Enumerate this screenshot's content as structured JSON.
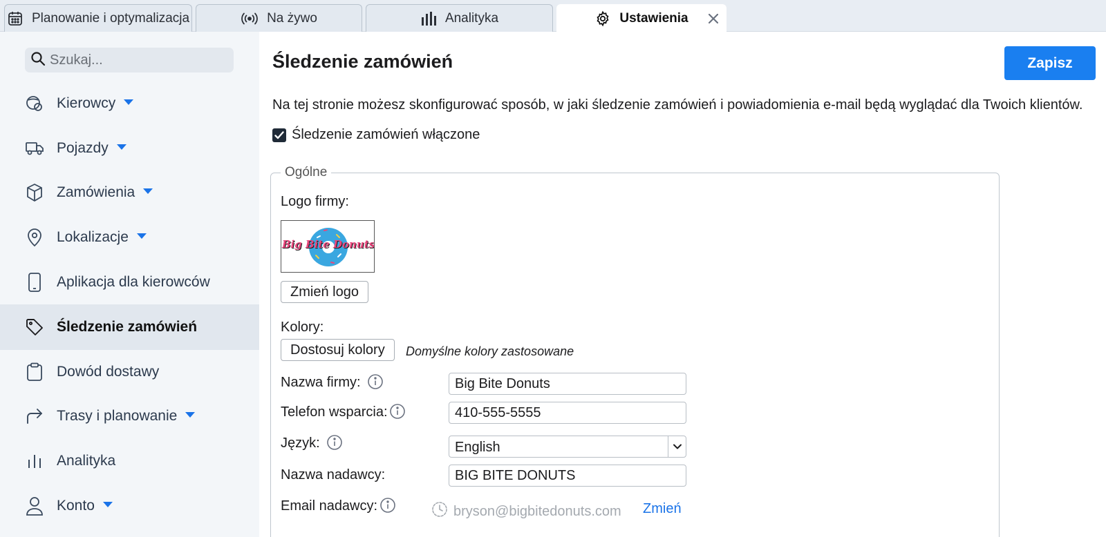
{
  "tabs": [
    {
      "label": "Planowanie i optymalizacja",
      "icon": "calendar-icon",
      "active": false
    },
    {
      "label": "Na żywo",
      "icon": "broadcast-icon",
      "active": false
    },
    {
      "label": "Analityka",
      "icon": "bar-chart-icon",
      "active": false
    },
    {
      "label": "Ustawienia",
      "icon": "gear-icon",
      "active": true
    }
  ],
  "sidebar": {
    "search_placeholder": "Szukaj...",
    "items": [
      {
        "label": "Kierowcy",
        "icon": "driver-icon",
        "has_dropdown": true
      },
      {
        "label": "Pojazdy",
        "icon": "truck-icon",
        "has_dropdown": true
      },
      {
        "label": "Zamówienia",
        "icon": "box-icon",
        "has_dropdown": true
      },
      {
        "label": "Lokalizacje",
        "icon": "map-pin-icon",
        "has_dropdown": true
      },
      {
        "label": "Aplikacja dla kierowców",
        "icon": "phone-icon",
        "has_dropdown": false
      },
      {
        "label": "Śledzenie zamówień",
        "icon": "tag-icon",
        "has_dropdown": false,
        "active": true
      },
      {
        "label": "Dowód dostawy",
        "icon": "clipboard-icon",
        "has_dropdown": false
      },
      {
        "label": "Trasy i planowanie",
        "icon": "route-arrow-icon",
        "has_dropdown": true
      },
      {
        "label": "Analityka",
        "icon": "analytics-icon",
        "has_dropdown": false
      },
      {
        "label": "Konto",
        "icon": "user-icon",
        "has_dropdown": true
      }
    ]
  },
  "main": {
    "title": "Śledzenie zamówień",
    "save_label": "Zapisz",
    "description": "Na tej stronie możesz skonfigurować sposób, w jaki śledzenie zamówień i powiadomienia e-mail będą wyglądać dla Twoich klientów.",
    "tracking_enabled_label": "Śledzenie zamówień włączone",
    "tracking_enabled": true,
    "general": {
      "legend": "Ogólne",
      "logo_label": "Logo firmy:",
      "logo_text": "Big Bite Donuts",
      "change_logo_label": "Zmień logo",
      "colors_label": "Kolory:",
      "customize_colors_label": "Dostosuj kolory",
      "colors_note": "Domyślne kolory zastosowane",
      "company_name_label": "Nazwa firmy:",
      "company_name_value": "Big Bite Donuts",
      "support_phone_label": "Telefon wsparcia:",
      "support_phone_value": "410-555-5555",
      "language_label": "Język:",
      "language_value": "English",
      "sender_name_label": "Nazwa nadawcy:",
      "sender_name_value": "BIG BITE DONUTS",
      "sender_email_label": "Email nadawcy:",
      "sender_email_value": "bryson@bigbitedonuts.com",
      "change_label": "Zmień"
    }
  },
  "colors": {
    "accent": "#1a7ff0",
    "link": "#1a73e8",
    "sidebar_bg": "#f3f6f9",
    "logo_pink": "#e8467c",
    "logo_blue": "#3aa7e0"
  }
}
